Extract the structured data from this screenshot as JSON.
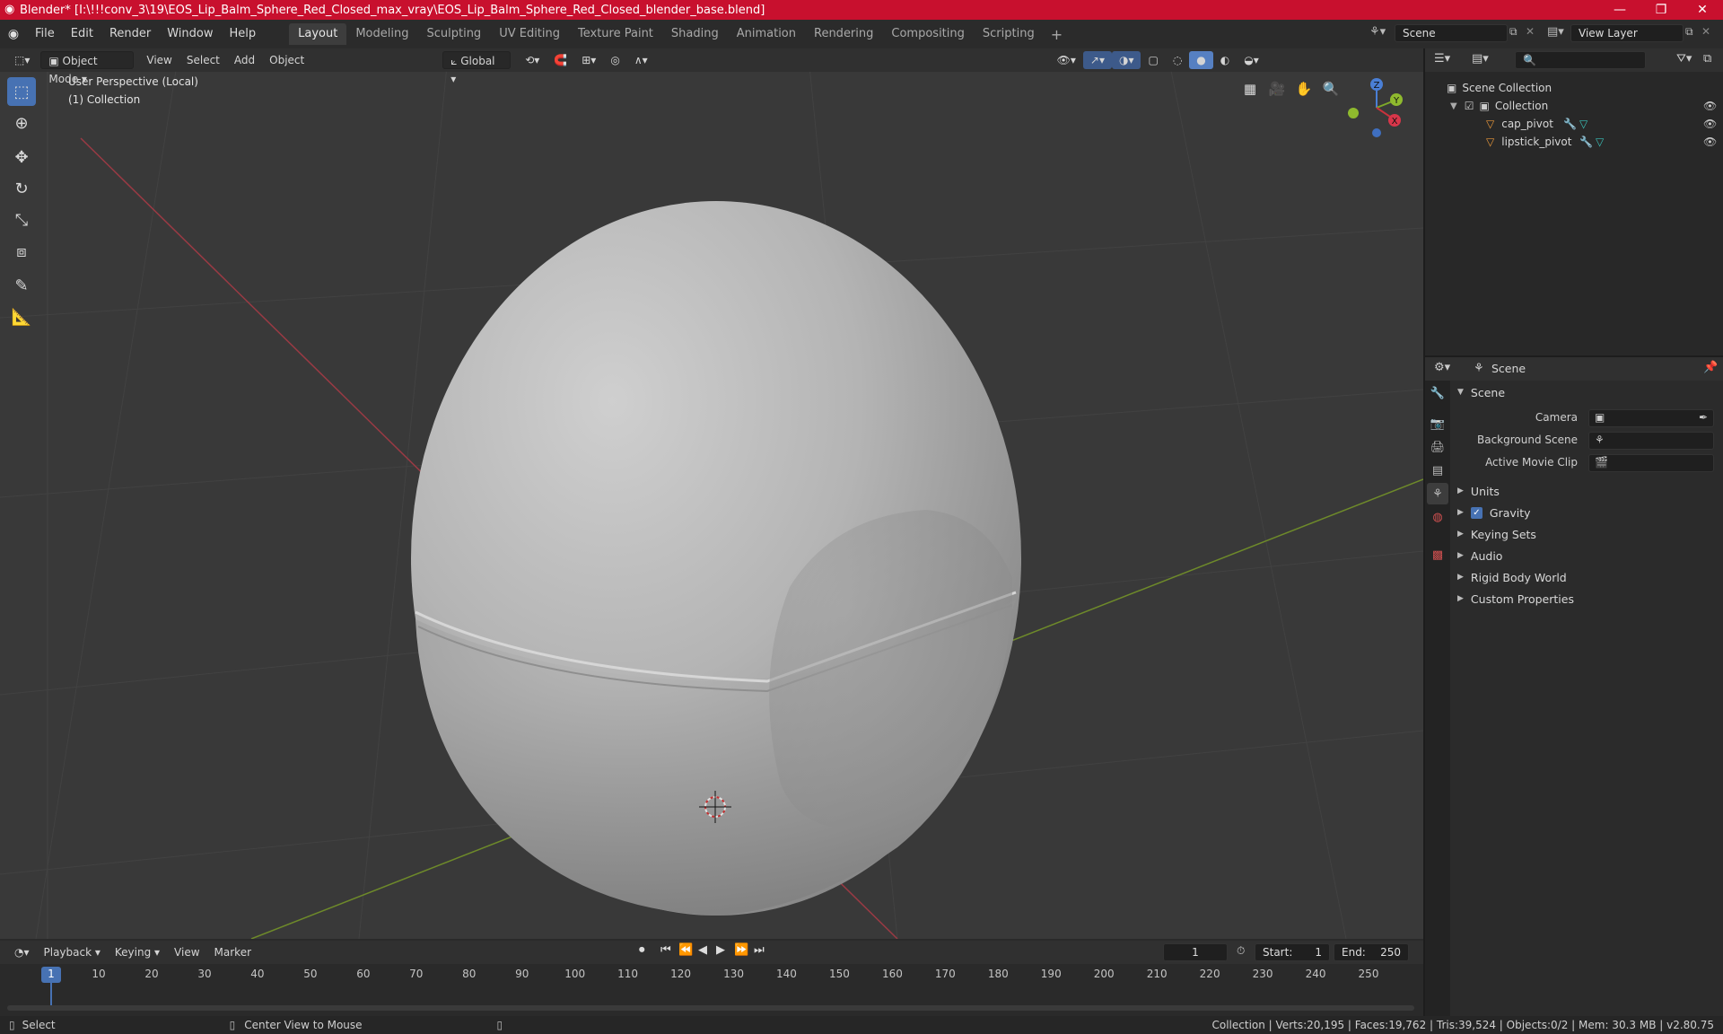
{
  "titlebar": {
    "title": "Blender* [I:\\!!!conv_3\\19\\EOS_Lip_Balm_Sphere_Red_Closed_max_vray\\EOS_Lip_Balm_Sphere_Red_Closed_blender_base.blend]"
  },
  "menu": {
    "items": [
      "File",
      "Edit",
      "Render",
      "Window",
      "Help"
    ],
    "workspaces": [
      "Layout",
      "Modeling",
      "Sculpting",
      "UV Editing",
      "Texture Paint",
      "Shading",
      "Animation",
      "Rendering",
      "Compositing",
      "Scripting"
    ],
    "active_workspace": "Layout",
    "scene_name": "Scene",
    "view_layer": "View Layer"
  },
  "viewport": {
    "mode": "Object Mode",
    "menus": [
      "View",
      "Select",
      "Add",
      "Object"
    ],
    "orientation": "Global",
    "info_line1": "User Perspective (Local)",
    "info_line2": "(1) Collection",
    "gizmo": {
      "x": "X",
      "y": "Y",
      "z": "Z"
    }
  },
  "outliner": {
    "root": "Scene Collection",
    "collection": "Collection",
    "objects": [
      "cap_pivot",
      "lipstick_pivot"
    ]
  },
  "properties": {
    "context": "Scene",
    "section": "Scene",
    "fields": {
      "camera_label": "Camera",
      "background_scene_label": "Background Scene",
      "active_movie_clip_label": "Active Movie Clip"
    },
    "panels": [
      "Units",
      "Gravity",
      "Keying Sets",
      "Audio",
      "Rigid Body World",
      "Custom Properties"
    ],
    "gravity_checked": true
  },
  "timeline": {
    "menus": [
      "Playback",
      "Keying",
      "View",
      "Marker"
    ],
    "current_frame": "1",
    "start_label": "Start:",
    "start_value": "1",
    "end_label": "End:",
    "end_value": "250",
    "ticks": [
      "1",
      "10",
      "20",
      "30",
      "40",
      "50",
      "60",
      "70",
      "80",
      "90",
      "100",
      "110",
      "120",
      "130",
      "140",
      "150",
      "160",
      "170",
      "180",
      "190",
      "200",
      "210",
      "220",
      "230",
      "240",
      "250"
    ]
  },
  "statusbar": {
    "select": "Select",
    "center_view": "Center View to Mouse",
    "stats": "Collection | Verts:20,195 | Faces:19,762 | Tris:39,524 | Objects:0/2 | Mem: 30.3 MB | v2.80.75"
  }
}
